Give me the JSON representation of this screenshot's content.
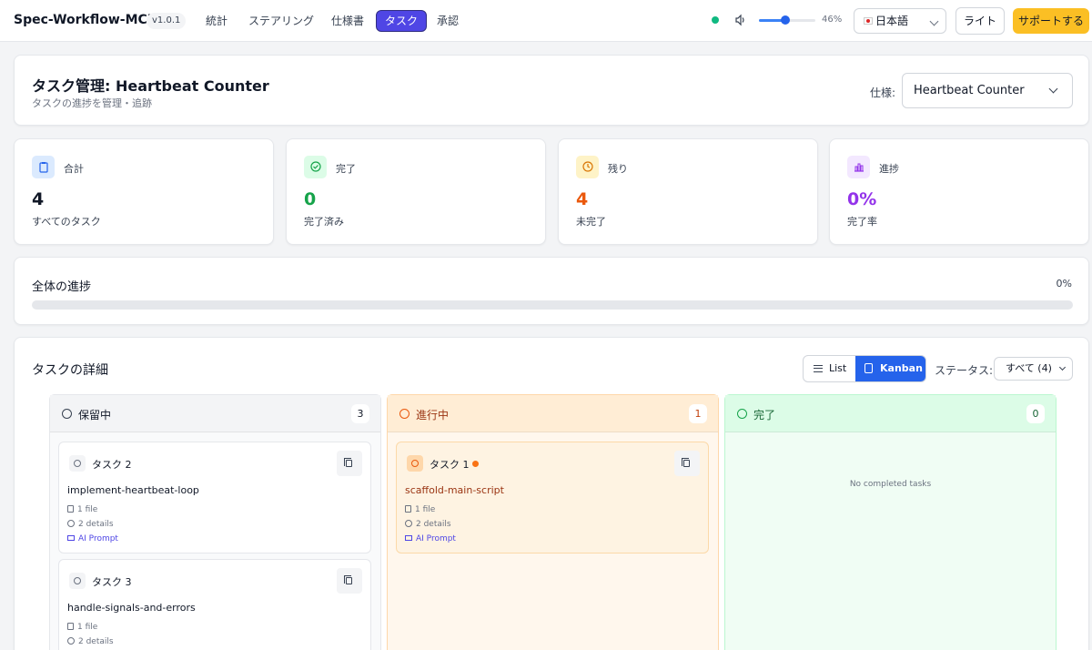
{
  "header": {
    "brand": "Spec-Workflow-MCP",
    "version": "v1.0.1",
    "nav": [
      {
        "label": "統計",
        "active": false
      },
      {
        "label": "ステアリング",
        "active": false
      },
      {
        "label": "仕様書",
        "active": false
      },
      {
        "label": "タスク",
        "active": true
      },
      {
        "label": "承認",
        "active": false
      }
    ],
    "volume_percent": 46,
    "volume_label": "46%",
    "language": "日本語",
    "theme_label": "ライト",
    "support_label": "サポートする"
  },
  "page": {
    "title": "タスク管理: Heartbeat Counter",
    "subtitle": "タスクの進捗を管理・追跡",
    "spec_label": "仕様:",
    "spec_value": "Heartbeat Counter"
  },
  "stats": [
    {
      "label": "合計",
      "value": "4",
      "desc": "すべてのタスク",
      "color": "#111827",
      "icon": "clipboard-icon",
      "icon_bg": "#dbeafe",
      "icon_color": "#2563eb"
    },
    {
      "label": "完了",
      "value": "0",
      "desc": "完了済み",
      "color": "#16a34a",
      "icon": "check-circle-icon",
      "icon_bg": "#dcfce7",
      "icon_color": "#16a34a"
    },
    {
      "label": "残り",
      "value": "4",
      "desc": "未完了",
      "color": "#ea580c",
      "icon": "clock-icon",
      "icon_bg": "#fef3c7",
      "icon_color": "#d97706"
    },
    {
      "label": "進捗",
      "value": "0%",
      "desc": "完了率",
      "color": "#9333ea",
      "icon": "chart-icon",
      "icon_bg": "#f3e8ff",
      "icon_color": "#9333ea"
    }
  ],
  "progress": {
    "title": "全体の進捗",
    "percent_label": "0%",
    "fraction": 0
  },
  "details": {
    "title": "タスクの詳細",
    "view_list": "List",
    "view_kanban": "Kanban",
    "status_label": "ステータス:",
    "status_value": "すべて (4)"
  },
  "kanban": {
    "pending": {
      "title": "保留中",
      "count": "3",
      "tasks": [
        {
          "title": "タスク 2",
          "name": "implement-heartbeat-loop",
          "files": "1 file",
          "details": "2 details",
          "ai": "AI Prompt"
        },
        {
          "title": "タスク 3",
          "name": "handle-signals-and-errors",
          "files": "1 file",
          "details": "2 details"
        }
      ]
    },
    "in_progress": {
      "title": "進行中",
      "count": "1",
      "tasks": [
        {
          "title": "タスク 1",
          "name": "scaffold-main-script",
          "files": "1 file",
          "details": "2 details",
          "ai": "AI Prompt"
        }
      ]
    },
    "done": {
      "title": "完了",
      "count": "0",
      "empty": "No completed tasks"
    }
  },
  "colors": {
    "accent": "#4f46e5",
    "kanban_active": "#2563eb",
    "support": "#fbbf24",
    "pending_bg": "#f9fafb",
    "in_progress_bg": "#fff7ed",
    "done_bg": "#f0fdf4"
  }
}
